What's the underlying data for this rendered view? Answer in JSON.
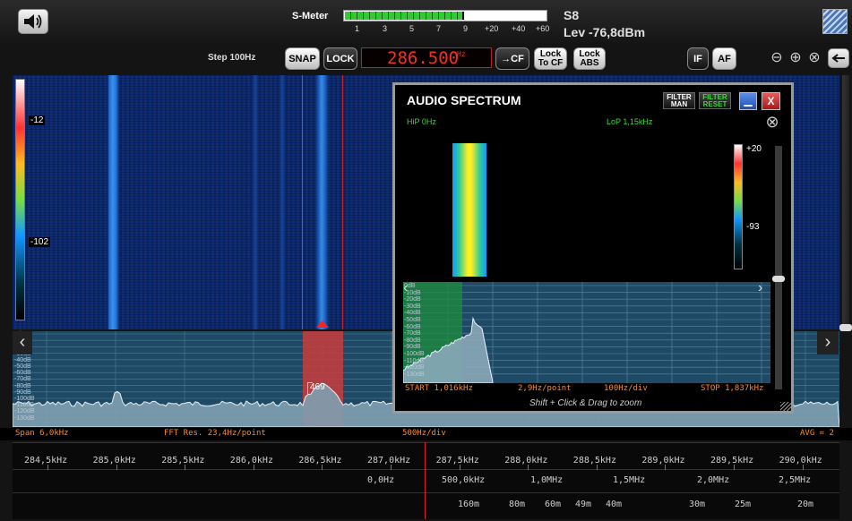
{
  "topbar": {
    "smeter_label": "S-Meter",
    "smeter_scale": [
      "1",
      "3",
      "5",
      "7",
      "9",
      "+20",
      "+40",
      "+60"
    ],
    "smeter_level": 0.58,
    "s_reading": "S8",
    "level_reading": "Lev -76,8dBm"
  },
  "controls": {
    "step_label": "Step 100Hz",
    "snap": "SNAP",
    "lock": "LOCK",
    "frequency": "286.500",
    "frequency_unit": "Hz",
    "cf": "→CF",
    "lock_to_cf": [
      "Lock",
      "To CF"
    ],
    "lock_abs": [
      "Lock",
      "ABS"
    ],
    "if": "IF",
    "af": "AF"
  },
  "waterfall": {
    "colorbar_ticks": [
      "-12",
      "-102"
    ]
  },
  "spectrum": {
    "db_labels": [
      "0dB",
      "-10dB",
      "-20dB",
      "-30dB",
      "-40dB",
      "-50dB",
      "-60dB",
      "-70dB",
      "-80dB",
      "-90dB",
      "-100dB",
      "-110dB",
      "-120dB",
      "-130dB"
    ],
    "peak_label": "469"
  },
  "status": {
    "span": "Span 6,0kHz",
    "fft": "FFT Res. 23,4Hz/point",
    "div": "500Hz/div",
    "avg": "AVG = 2"
  },
  "freq_scale": [
    "284,5kHz",
    "285,0kHz",
    "285,5kHz",
    "286,0kHz",
    "286,5kHz",
    "287,0kHz",
    "287,5kHz",
    "288,0kHz",
    "288,5kHz",
    "289,0kHz",
    "289,5kHz",
    "290,0kHz"
  ],
  "mhz_scale": [
    "0,0Hz",
    "500,0kHz",
    "1,0MHz",
    "1,5MHz",
    "2,0MHz",
    "2,5MHz"
  ],
  "band_scale": [
    "160m",
    "80m",
    "60m",
    "49m",
    "40m",
    "30m",
    "25m",
    "20m"
  ],
  "audio": {
    "title": "AUDIO SPECTRUM",
    "hip": "HiP 0Hz",
    "lop": "LoP 1,15kHz",
    "filter_man": [
      "FILTER",
      "MAN"
    ],
    "filter_reset": [
      "FILTER",
      "RESET"
    ],
    "colorbar_ticks": [
      "+20",
      "-93"
    ],
    "start": "START 1,016kHz",
    "res": "2,9Hz/point",
    "div": "100Hz/div",
    "stop": "STOP 1,837kHz",
    "hint": "Shift + Click & Drag to zoom",
    "db_labels": [
      "0dB",
      "-10dB",
      "-20dB",
      "-30dB",
      "-40dB",
      "-50dB",
      "-60dB",
      "-70dB",
      "-80dB",
      "-90dB",
      "-100dB",
      "-110dB",
      "-120dB",
      "-130dB"
    ]
  },
  "colors": {
    "accent_red": "#ff2020",
    "spectrum_fill": "#7fa0b0",
    "status_orange": "#ff8a1c",
    "filter_green": "#39d839"
  }
}
